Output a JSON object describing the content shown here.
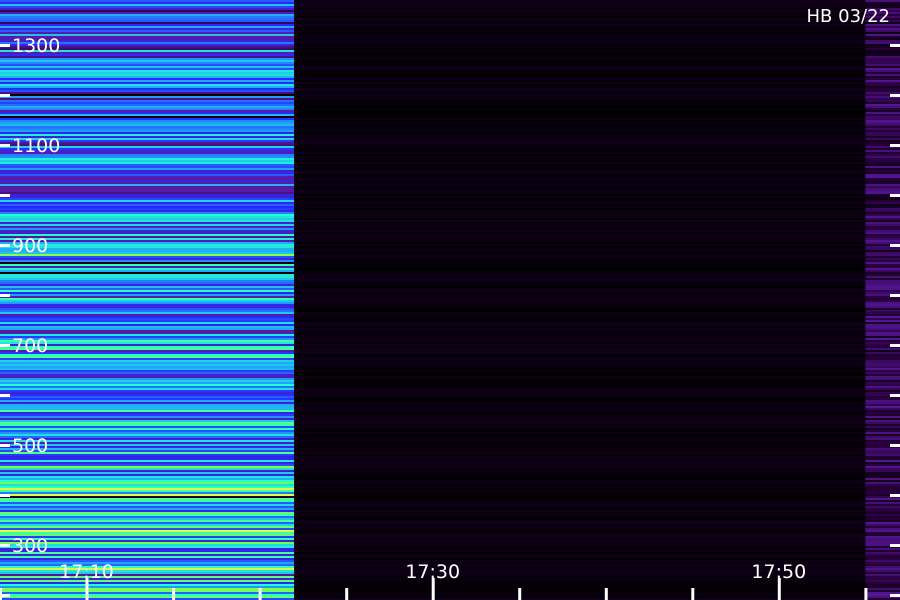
{
  "label": "HB 03/22",
  "chart_data": {
    "type": "heatmap",
    "title": "",
    "xlabel": "",
    "ylabel": "",
    "x_tick_labels": [
      "17:10",
      "17:30",
      "17:50"
    ],
    "x_tick_values": [
      "17:10",
      "17:30",
      "17:50"
    ],
    "x_minor_ticks": [
      "17:05",
      "17:15",
      "17:20",
      "17:25",
      "17:35",
      "17:40",
      "17:45",
      "17:55"
    ],
    "xlim": [
      "17:05",
      "17:57"
    ],
    "y_tick_labels": [
      "1300",
      "1100",
      "900",
      "700",
      "500",
      "300"
    ],
    "y_tick_values": [
      1300,
      1100,
      900,
      700,
      500,
      300
    ],
    "y_minor_ticks": [
      1200,
      1000,
      800,
      600,
      400,
      200
    ],
    "ylim": [
      190,
      1390
    ],
    "data_segments": [
      {
        "start": "17:05",
        "end": "17:22",
        "level": "high"
      },
      {
        "start": "17:22",
        "end": "17:55",
        "level": "near-zero"
      },
      {
        "start": "17:55",
        "end": "17:57",
        "level": "low"
      }
    ],
    "grid": false,
    "legend": "none",
    "colormap": [
      "#000000",
      "#2a0040",
      "#5a1aa0",
      "#2828ff",
      "#20a0ff",
      "#20ffd0",
      "#80ff40",
      "#e0ff40"
    ],
    "tick_color": "#ffffff",
    "background": "#000000"
  }
}
